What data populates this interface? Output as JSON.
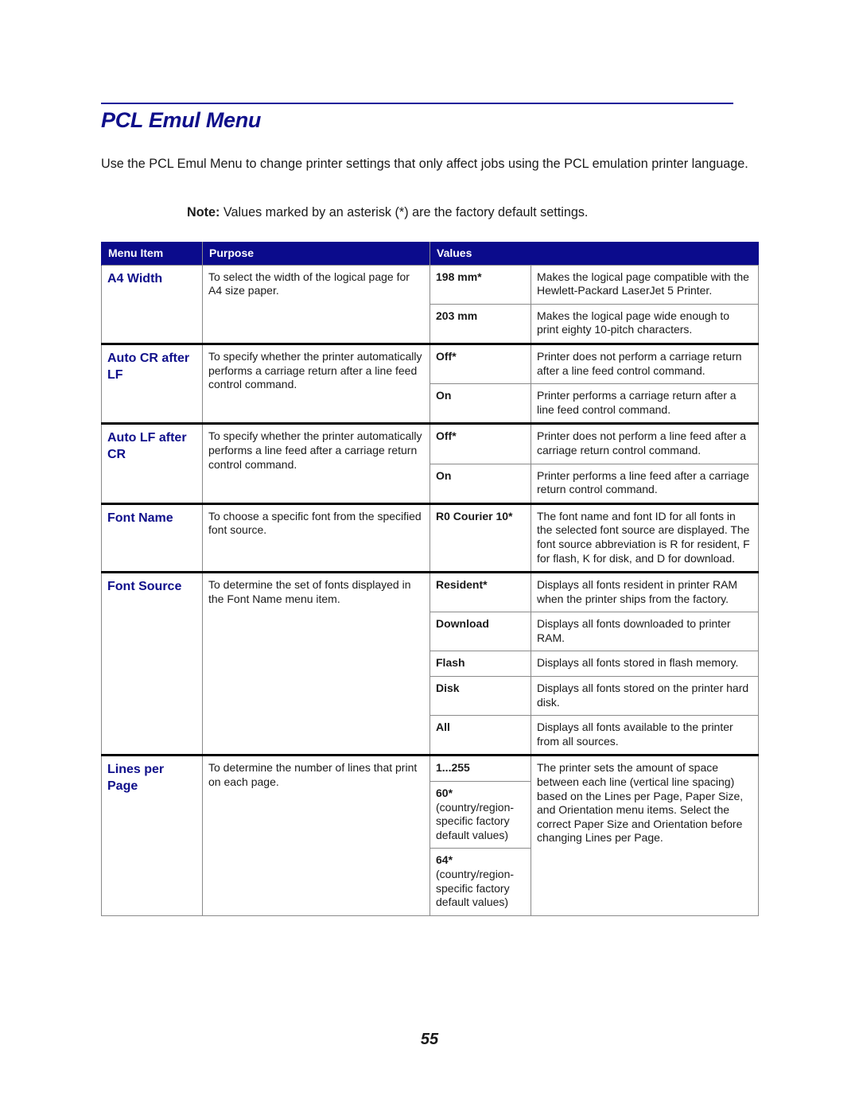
{
  "page": {
    "title": "PCL Emul Menu",
    "intro": "Use the PCL Emul Menu to change printer settings that only affect jobs using the PCL emulation printer language.",
    "note_label": "Note:",
    "note_text": " Values marked by an asterisk (*) are the factory default settings.",
    "page_number": "55"
  },
  "table": {
    "headers": {
      "menu_item": "Menu Item",
      "purpose": "Purpose",
      "values": "Values"
    },
    "groups": [
      {
        "item": "A4 Width",
        "purpose": "To select the width of the logical page for A4 size paper.",
        "values": [
          {
            "value": "198 mm*",
            "description": "Makes the logical page compatible with the Hewlett-Packard LaserJet 5 Printer."
          },
          {
            "value": "203 mm",
            "description": "Makes the logical page wide enough to print eighty 10-pitch characters."
          }
        ]
      },
      {
        "item": "Auto CR after LF",
        "purpose": "To specify whether the printer automatically performs a carriage return after a line feed control command.",
        "values": [
          {
            "value": "Off*",
            "description": "Printer does not perform a carriage return after a line feed control command."
          },
          {
            "value": "On",
            "description": "Printer performs a carriage return after a line feed control command."
          }
        ]
      },
      {
        "item": "Auto LF after CR",
        "purpose": "To specify whether the printer automatically performs a line feed after a carriage return control command.",
        "values": [
          {
            "value": "Off*",
            "description": "Printer does not perform a line feed after a carriage return control command."
          },
          {
            "value": "On",
            "description": "Printer performs a line feed after a carriage return control command."
          }
        ]
      },
      {
        "item": "Font Name",
        "purpose": "To choose a specific font from the specified font source.",
        "values": [
          {
            "value": "R0 Courier 10*",
            "description": "The font name and font ID for all fonts in the selected font source are displayed. The font source abbreviation is R for resident, F for flash, K for disk, and D for download."
          }
        ]
      },
      {
        "item": "Font Source",
        "purpose": "To determine the set of fonts displayed in the Font Name menu item.",
        "values": [
          {
            "value": "Resident*",
            "description": "Displays all fonts resident in printer RAM when the printer ships from the factory."
          },
          {
            "value": "Download",
            "description": "Displays all fonts downloaded to printer RAM."
          },
          {
            "value": "Flash",
            "description": "Displays all fonts stored in flash memory."
          },
          {
            "value": "Disk",
            "description": "Displays all fonts stored on the printer hard disk."
          },
          {
            "value": "All",
            "description": "Displays all fonts available to the printer from all sources."
          }
        ]
      },
      {
        "item": "Lines per Page",
        "purpose": "To determine the number of lines that print on each page.",
        "shared_description": "The printer sets the amount of space between each line (vertical line spacing) based on the Lines per Page, Paper Size, and Orientation menu items. Select the correct Paper Size and Orientation before changing Lines per Page.",
        "values": [
          {
            "value": "1...255",
            "note": ""
          },
          {
            "value": "60*",
            "note": "(country/region-specific factory default values)"
          },
          {
            "value": "64*",
            "note": "(country/region-specific factory default values)"
          }
        ]
      }
    ]
  }
}
